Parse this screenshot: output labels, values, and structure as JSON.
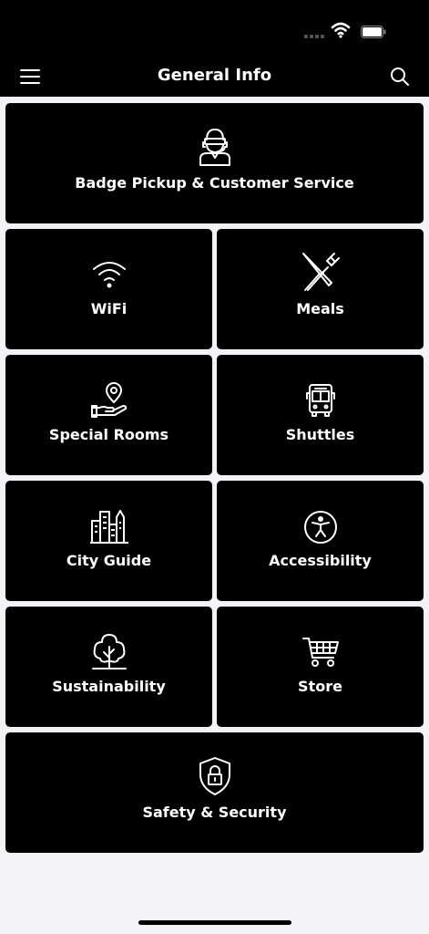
{
  "header": {
    "title": "General Info",
    "menu_icon": "hamburger-menu-icon",
    "search_icon": "search-icon"
  },
  "status_bar": {
    "icons": [
      "signal-icon",
      "wifi-icon",
      "battery-icon"
    ]
  },
  "tiles": [
    {
      "label": "Badge Pickup & Customer Service",
      "icon": "customer-service-agent-icon"
    },
    {
      "label": "WiFi",
      "icon": "wifi-icon"
    },
    {
      "label": "Meals",
      "icon": "fork-knife-icon"
    },
    {
      "label": "Special Rooms",
      "icon": "location-hand-icon"
    },
    {
      "label": "Shuttles",
      "icon": "bus-icon"
    },
    {
      "label": "City Guide",
      "icon": "city-buildings-icon"
    },
    {
      "label": "Accessibility",
      "icon": "accessibility-icon"
    },
    {
      "label": "Sustainability",
      "icon": "tree-icon"
    },
    {
      "label": "Store",
      "icon": "shopping-cart-icon"
    },
    {
      "label": "Safety & Security",
      "icon": "shield-lock-icon"
    }
  ],
  "colors": {
    "tile_bg": "#000000",
    "page_bg": "#f2f2f7",
    "text": "#ffffff"
  }
}
